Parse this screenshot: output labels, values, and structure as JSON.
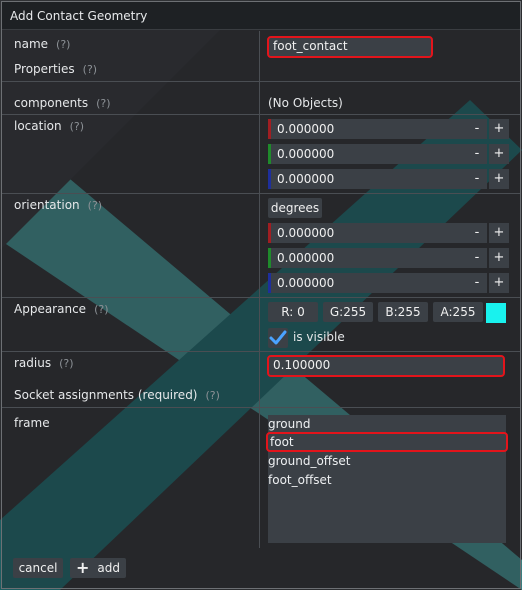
{
  "dialog": {
    "title": "Add Contact Geometry"
  },
  "help_marker": "(?)",
  "name": {
    "label": "name",
    "value": "foot_contact"
  },
  "properties": {
    "label": "Properties"
  },
  "components": {
    "label": "components",
    "value": "(No Objects)"
  },
  "location": {
    "label": "location",
    "values": [
      "0.000000",
      "0.000000",
      "0.000000"
    ],
    "axis_colors": [
      "#a01e22",
      "#1f8a2b",
      "#1e2f9c"
    ]
  },
  "orientation": {
    "label": "orientation",
    "unit_button": "degrees",
    "values": [
      "0.000000",
      "0.000000",
      "0.000000"
    ]
  },
  "stepper": {
    "minus": "-",
    "plus": "+"
  },
  "appearance": {
    "label": "Appearance",
    "r": "R:  0",
    "g": "G:255",
    "b": "B:255",
    "a": "A:255",
    "swatch_color": "#19f2ee",
    "visible_label": "is visible",
    "visible_checked": true
  },
  "radius": {
    "label": "radius",
    "value": "0.100000"
  },
  "sockets": {
    "label": "Socket assignments (required)",
    "frame_label": "frame",
    "options": [
      "ground",
      "foot",
      "ground_offset",
      "foot_offset"
    ],
    "selected": "foot"
  },
  "footer": {
    "cancel": "cancel",
    "add": "add"
  },
  "colors": {
    "highlight": "#e3141b",
    "field_bg": "#3b4046"
  }
}
